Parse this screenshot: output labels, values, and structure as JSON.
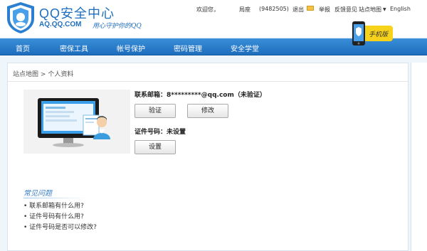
{
  "header": {
    "logo_title": "QQ安全中心",
    "logo_domain": "AQ.QQ.COM",
    "logo_slogan": "用心守护你的QQ",
    "topbar": {
      "welcome": "欢迎您，",
      "nickname": "局座",
      "qq_number": "(9482505)",
      "logout": "退出",
      "report": "举报",
      "feedback": "反馈意见",
      "sitemap": "站点地图",
      "language": "English"
    },
    "mobile_promo_label": "手机版"
  },
  "nav": {
    "items": [
      "首页",
      "密保工具",
      "帐号保护",
      "密码管理",
      "安全学堂"
    ]
  },
  "breadcrumb": {
    "root": "站点地图",
    "separator": ">",
    "current": "个人资料"
  },
  "profile": {
    "email_label": "联系邮箱：",
    "email_value": "8*********@qq.com（未验证）",
    "verify_button": "验证",
    "modify_button": "修改",
    "id_label": "证件号码：",
    "id_value": "未设置",
    "setup_button": "设置"
  },
  "faq": {
    "title": "常见问题",
    "items": [
      "联系邮箱有什么用?",
      "证件号码有什么用?",
      "证件号码是否可以修改?"
    ]
  },
  "colors": {
    "brand_blue": "#1f6fbf",
    "nav_bg": "#2a7fcc",
    "mail_icon": "#f5c242",
    "promo_yellow": "#f7d21a"
  }
}
